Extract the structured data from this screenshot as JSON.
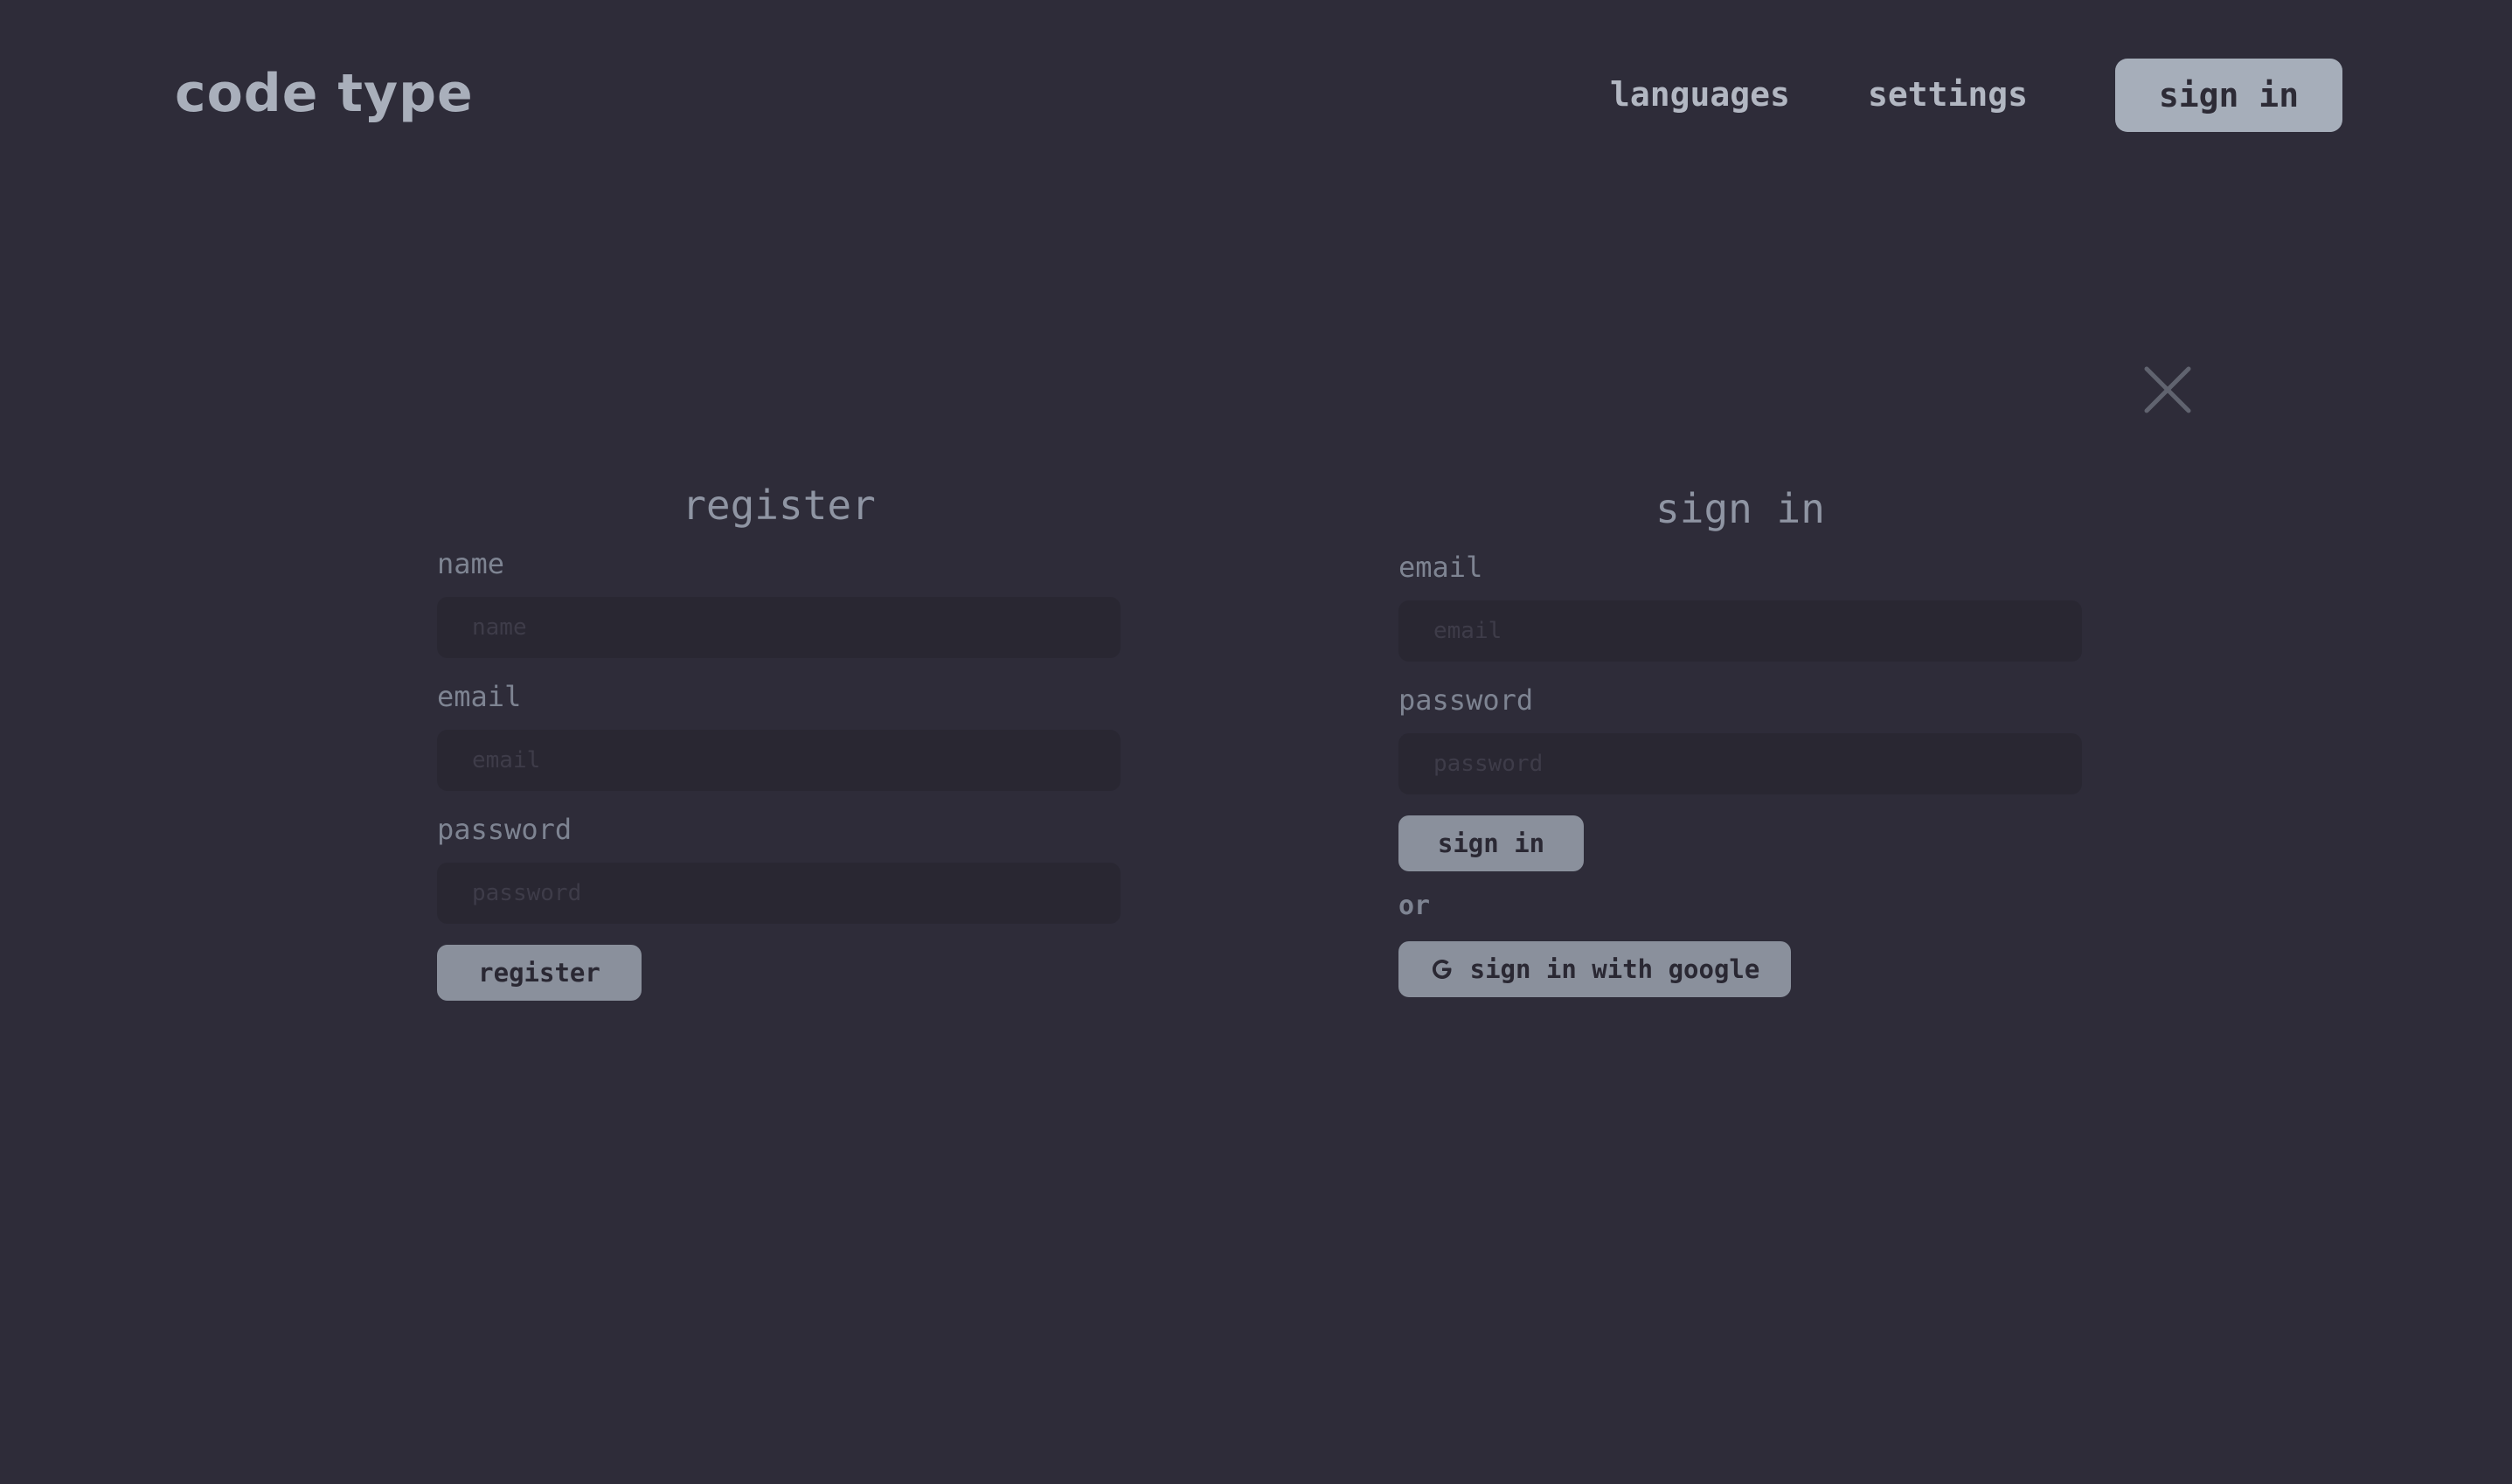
{
  "header": {
    "logo": "code type",
    "nav": {
      "languages": "languages",
      "settings": "settings"
    },
    "signin_button": "sign in"
  },
  "close_icon": "close-icon",
  "register": {
    "title": "register",
    "name_label": "name",
    "name_placeholder": "name",
    "email_label": "email",
    "email_placeholder": "email",
    "password_label": "password",
    "password_placeholder": "password",
    "submit": "register"
  },
  "signin": {
    "title": "sign in",
    "email_label": "email",
    "email_placeholder": "email",
    "password_label": "password",
    "password_placeholder": "password",
    "submit": "sign in",
    "or": "or",
    "google_button": "sign in with google",
    "google_icon": "google-icon"
  },
  "colors": {
    "background": "#2e2c39",
    "input_background": "#292732",
    "button_background": "#8a909c",
    "header_button_background": "#a6aeba",
    "text": "#9aa1ae"
  }
}
